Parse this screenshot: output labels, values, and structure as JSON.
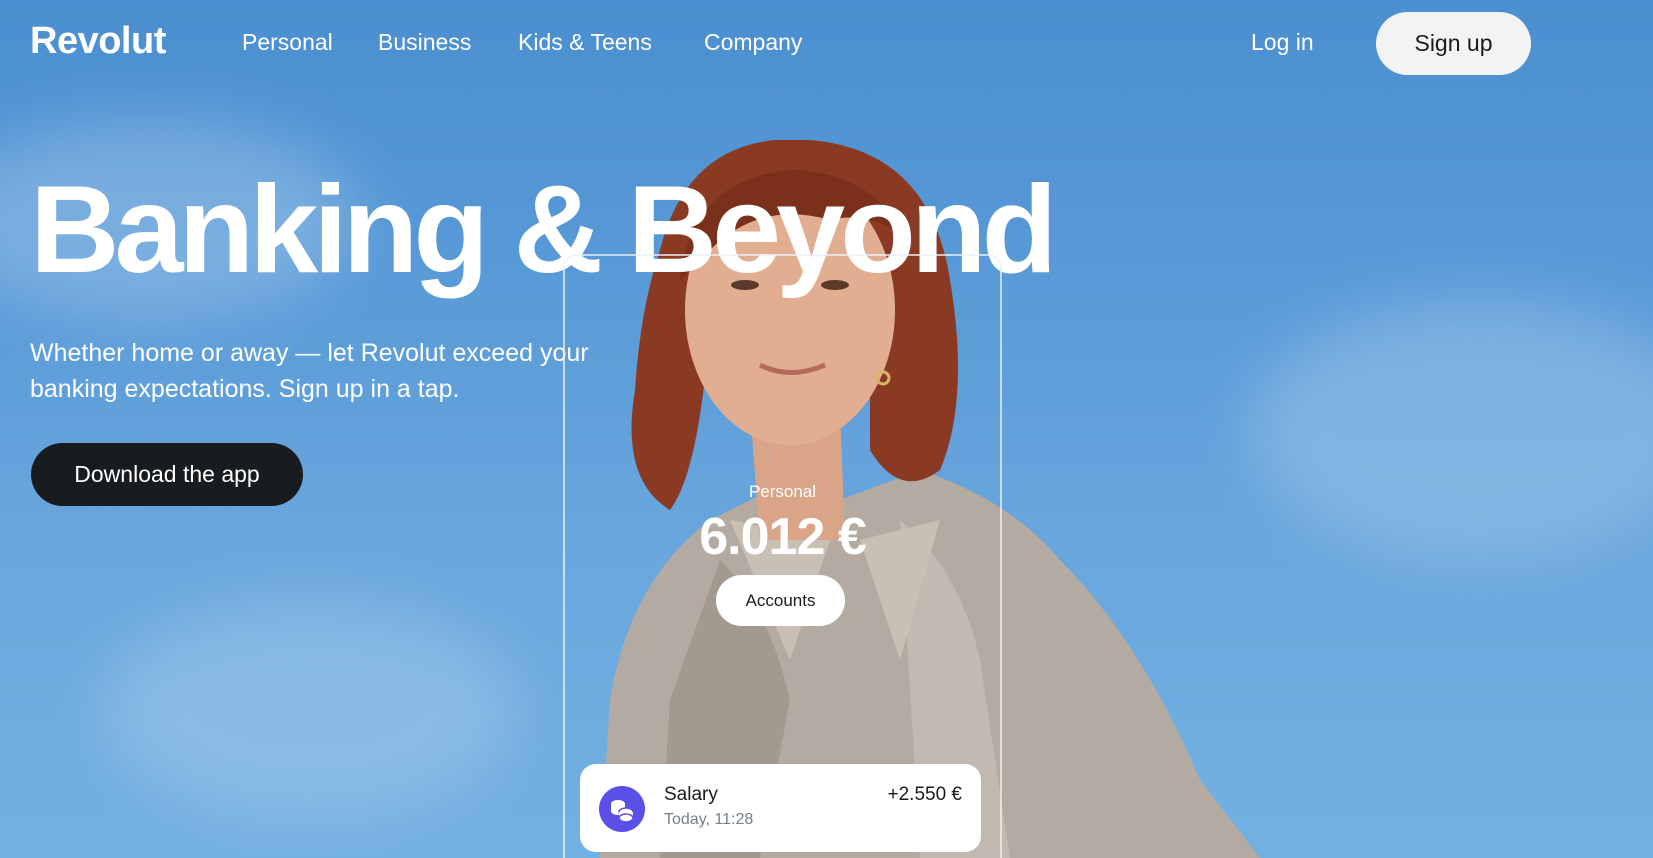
{
  "nav": {
    "logo": "Revolut",
    "links": [
      "Personal",
      "Business",
      "Kids & Teens",
      "Company"
    ],
    "login": "Log in",
    "signup": "Sign up"
  },
  "hero": {
    "title": "Banking & Beyond",
    "subtitle": "Whether home or away — let Revolut exceed your banking expectations. Sign up in a tap.",
    "cta": "Download the app"
  },
  "phone": {
    "account_label": "Personal",
    "balance": "6.012 €",
    "accounts_button": "Accounts",
    "transaction": {
      "title": "Salary",
      "time": "Today, 11:28",
      "amount": "+2.550 €",
      "icon": "coins-icon"
    }
  },
  "colors": {
    "sky": "#5a9bd8",
    "dark": "#191c1f",
    "accent": "#5a4fe6"
  }
}
